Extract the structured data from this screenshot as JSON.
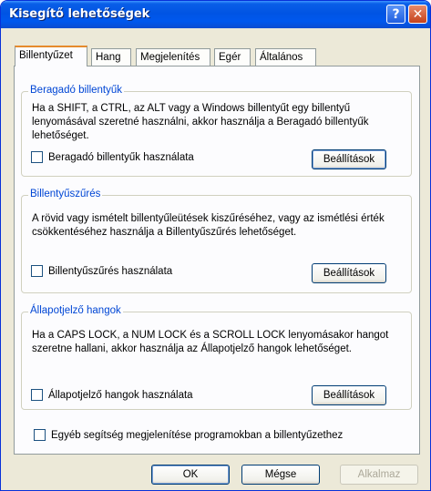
{
  "window": {
    "title": "Kisegítő lehetőségek"
  },
  "titlebar_buttons": {
    "help": "?",
    "close": "✕"
  },
  "tabs": [
    {
      "label": "Billentyűzet",
      "active": true
    },
    {
      "label": "Hang"
    },
    {
      "label": "Megjelenítés"
    },
    {
      "label": "Egér"
    },
    {
      "label": "Általános"
    }
  ],
  "groups": [
    {
      "title": "Beragadó billentyűk",
      "description": "Ha a SHIFT, a CTRL, az ALT vagy a Windows billentyűt egy billentyű lenyomásával szeretné használni, akkor használja a Beragadó billentyűk lehetőséget.",
      "checkbox_label": "Beragadó billentyűk használata",
      "checked": false,
      "button_label": "Beállítások"
    },
    {
      "title": "Billentyűszűrés",
      "description": "A rövid vagy ismételt billentyűleütések kiszűréséhez, vagy az ismétlési érték csökkentéséhez használja a Billentyűszűrés lehetőséget.",
      "checkbox_label": "Billentyűszűrés használata",
      "checked": false,
      "button_label": "Beállítások"
    },
    {
      "title": "Állapotjelző hangok",
      "description": "Ha a CAPS LOCK, a NUM LOCK és a SCROLL LOCK lenyomásakor hangot szeretne hallani, akkor használja az Állapotjelző hangok lehetőséget.",
      "checkbox_label": "Állapotjelző hangok használata",
      "checked": false,
      "button_label": "Beállítások"
    }
  ],
  "extra_checkbox": {
    "label": "Egyéb segítség megjelenítése programokban a billentyűzethez",
    "checked": false
  },
  "footer": {
    "ok": "OK",
    "cancel": "Mégse",
    "apply": "Alkalmaz"
  },
  "colors": {
    "title_bar": "#0054e3",
    "group_title": "#0046d5",
    "tab_highlight": "#e68b2c",
    "dialog_bg": "#ece9d8"
  }
}
